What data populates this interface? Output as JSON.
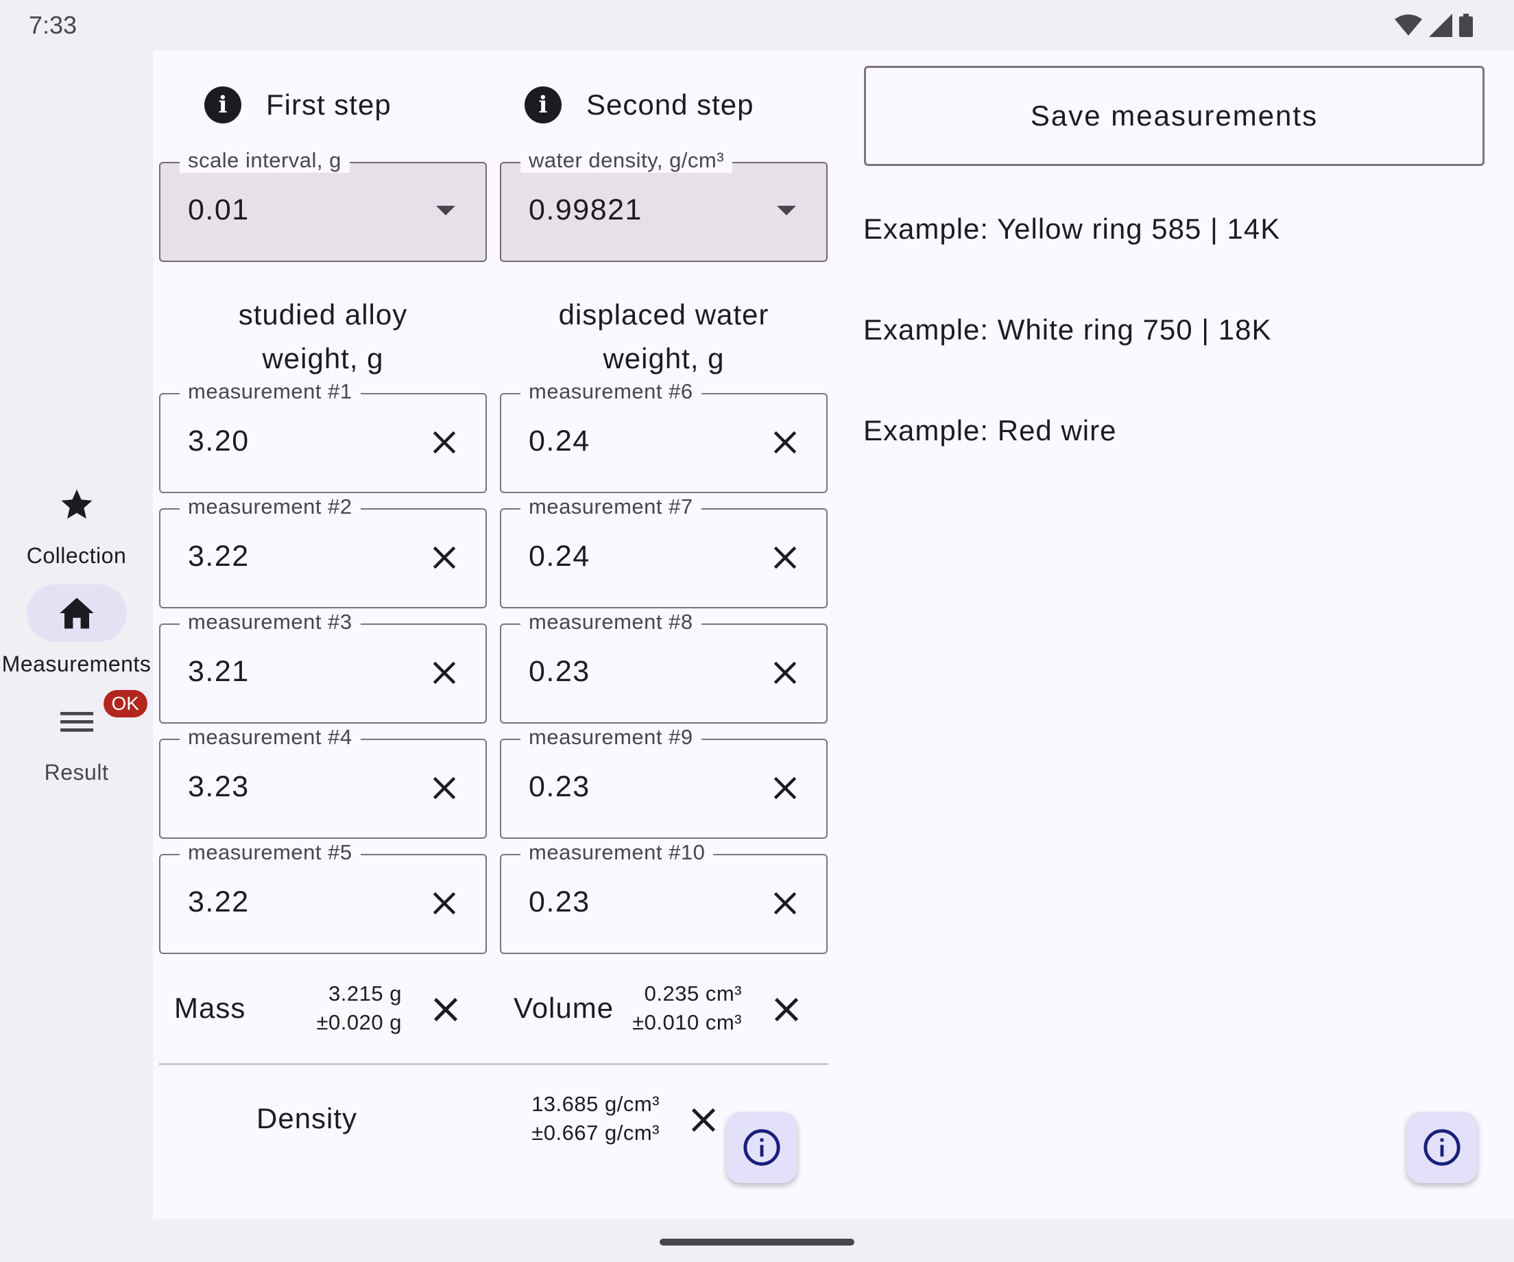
{
  "status_bar": {
    "time": "7:33"
  },
  "nav": [
    {
      "label": "Collection",
      "icon": "star-icon",
      "active": false
    },
    {
      "label": "Measurements",
      "icon": "home-icon",
      "active": true
    },
    {
      "label": "Result",
      "icon": "list-icon",
      "badge": "OK"
    }
  ],
  "steps": {
    "first": "First step",
    "second": "Second step"
  },
  "dropdowns": {
    "scale": {
      "label": "scale interval, g",
      "value": "0.01"
    },
    "water": {
      "label": "water density, g/cm³",
      "value": "0.99821"
    }
  },
  "columns": {
    "alloy": {
      "line1": "studied alloy",
      "line2": "weight, g"
    },
    "water": {
      "line1": "displaced water",
      "line2": "weight, g"
    }
  },
  "alloy_measurements": [
    {
      "label": "measurement #1",
      "value": "3.20"
    },
    {
      "label": "measurement #2",
      "value": "3.22"
    },
    {
      "label": "measurement #3",
      "value": "3.21"
    },
    {
      "label": "measurement #4",
      "value": "3.23"
    },
    {
      "label": "measurement #5",
      "value": "3.22"
    }
  ],
  "water_measurements": [
    {
      "label": "measurement #6",
      "value": "0.24"
    },
    {
      "label": "measurement #7",
      "value": "0.24"
    },
    {
      "label": "measurement #8",
      "value": "0.23"
    },
    {
      "label": "measurement #9",
      "value": "0.23"
    },
    {
      "label": "measurement #10",
      "value": "0.23"
    }
  ],
  "summary": {
    "mass": {
      "label": "Mass",
      "value": "3.215 g",
      "error": "±0.020 g"
    },
    "volume": {
      "label": "Volume",
      "value": "0.235 cm³",
      "error": "±0.010 cm³"
    },
    "density": {
      "label": "Density",
      "value": "13.685 g/cm³",
      "error": "±0.667 g/cm³"
    }
  },
  "save_button": "Save measurements",
  "examples": [
    "Example: Yellow ring 585 | 14K",
    "Example: White ring 750 | 18K",
    "Example: Red wire"
  ],
  "colors": {
    "accent_container": "#e3e1f4",
    "badge": "#b3261e",
    "surface": "#fbf8ff"
  }
}
